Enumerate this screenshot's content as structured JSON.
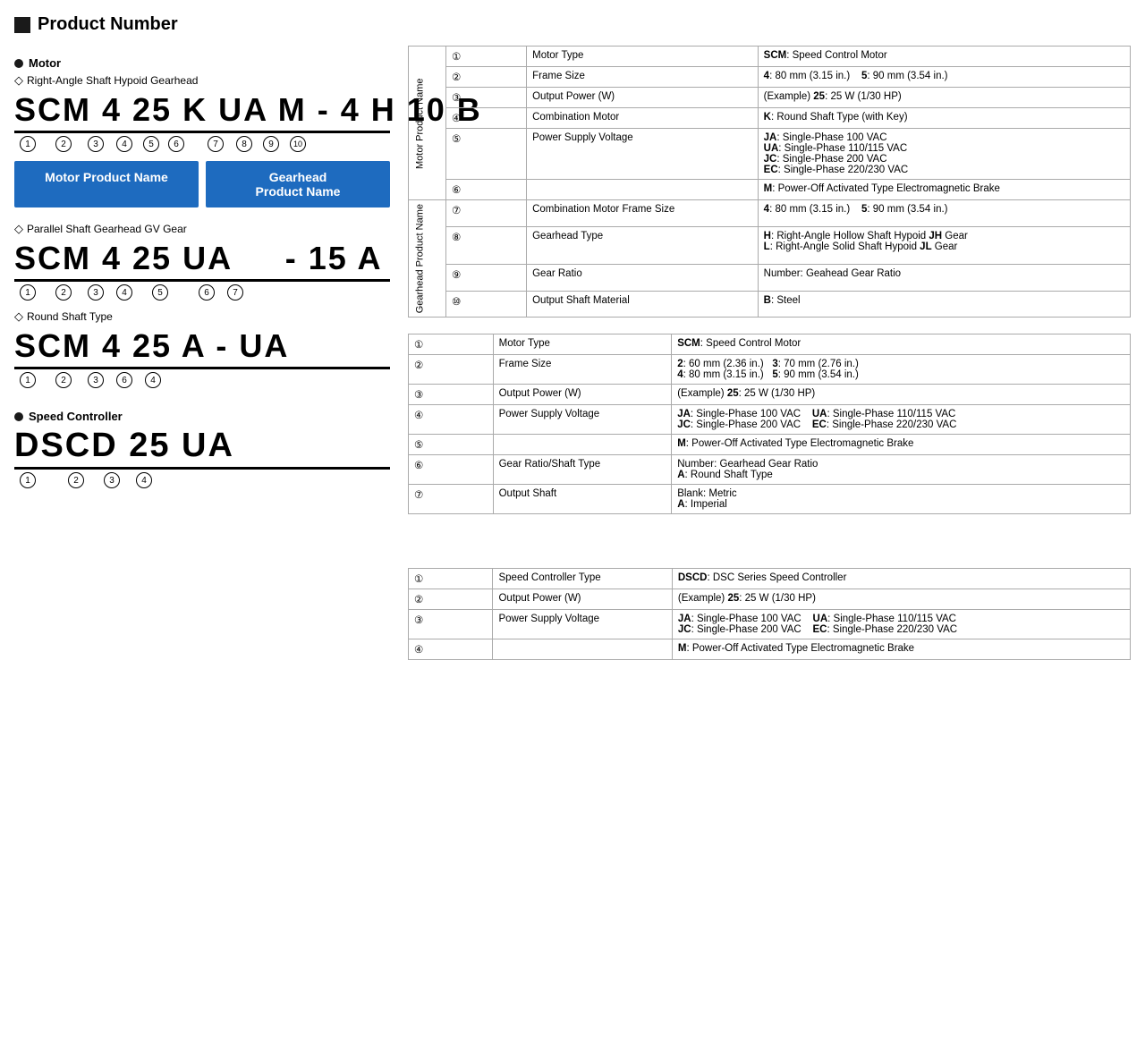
{
  "page": {
    "title": "Product Number",
    "sections": {
      "motor_label": "Motor",
      "right_angle_label": "Right-Angle Shaft Hypoid Gearhead",
      "parallel_label": "Parallel Shaft Gearhead GV Gear",
      "round_shaft_label": "Round Shaft Type",
      "speed_controller_label": "Speed Controller"
    },
    "codes": {
      "right_angle": "SCM 4 25 K UA M - 4 H 10 B",
      "parallel": "SCM 4 25 UA    - 15 A",
      "round_shaft": "SCM 4 25 A - UA"
    },
    "name_boxes": {
      "motor": "Motor Product Name",
      "gearhead": "Gearhead\nProduct Name"
    },
    "table1": {
      "group1_label": "Motor\nProduct\nName",
      "group2_label": "Gearhead\nProduct\nName",
      "rows": [
        {
          "num": "①",
          "field": "Motor Type",
          "value": "SCM: Speed Control Motor"
        },
        {
          "num": "②",
          "field": "Frame Size",
          "value": "4: 80 mm (3.15 in.)    5: 90 mm (3.54 in.)"
        },
        {
          "num": "③",
          "field": "Output Power (W)",
          "value": "(Example) 25: 25 W (1/30 HP)"
        },
        {
          "num": "④",
          "field": "Combination Motor",
          "value": "K: Round Shaft Type (with Key)"
        },
        {
          "num": "⑤",
          "field": "Power Supply Voltage",
          "value": "JA: Single-Phase 100 VAC\nUA: Single-Phase 110/115 VAC\nJC: Single-Phase 200 VAC\nEC: Single-Phase 220/230 VAC"
        },
        {
          "num": "⑥",
          "field": "",
          "value": "M: Power-Off Activated Type Electromagnetic Brake"
        },
        {
          "num": "⑦",
          "field": "Combination Motor\nFrame Size",
          "value": "4: 80 mm (3.15 in.)    5: 90 mm (3.54 in.)"
        },
        {
          "num": "⑧",
          "field": "Gearhead Type",
          "value": "H: Right-Angle Hollow Shaft Hypoid JH Gear\nL: Right-Angle Solid Shaft Hypoid JL Gear"
        },
        {
          "num": "⑨",
          "field": "Gear Ratio",
          "value": "Number: Geahead Gear Ratio"
        },
        {
          "num": "⑩",
          "field": "Output Shaft Material",
          "value": "B: Steel"
        }
      ]
    },
    "table2": {
      "rows": [
        {
          "num": "①",
          "field": "Motor Type",
          "value": "SCM: Speed Control Motor"
        },
        {
          "num": "②",
          "field": "Frame Size",
          "value": "2: 60 mm (2.36 in.)    3: 70 mm (2.76 in.)\n4: 80 mm (3.15 in.)    5: 90 mm (3.54 in.)"
        },
        {
          "num": "③",
          "field": "Output Power (W)",
          "value": "(Example) 25: 25 W (1/30 HP)"
        },
        {
          "num": "④",
          "field": "Power Supply Voltage",
          "value": "JA: Single-Phase 100 VAC    UA: Single-Phase 110/115 VAC\nJC: Single-Phase 200 VAC    EC: Single-Phase 220/230 VAC"
        },
        {
          "num": "⑤",
          "field": "",
          "value": "M: Power-Off Activated Type Electromagnetic Brake"
        },
        {
          "num": "⑥",
          "field": "Gear Ratio/Shaft\nType",
          "value": "Number: Gearhead Gear Ratio\nA: Round Shaft Type"
        },
        {
          "num": "⑦",
          "field": "Output Shaft",
          "value": "Blank: Metric\nA: Imperial"
        }
      ]
    },
    "table3": {
      "rows": [
        {
          "num": "①",
          "field": "Speed Controller\nType",
          "value": "DSCD: DSC Series Speed Controller"
        },
        {
          "num": "②",
          "field": "Output Power (W)",
          "value": "(Example) 25: 25 W (1/30 HP)"
        },
        {
          "num": "③",
          "field": "Power Supply Voltage",
          "value": "JA: Single-Phase 100 VAC    UA: Single-Phase 110/115 VAC\nJC: Single-Phase 200 VAC    EC: Single-Phase 220/230 VAC"
        },
        {
          "num": "④",
          "field": "",
          "value": "M: Power-Off Activated Type Electromagnetic Brake"
        }
      ]
    }
  }
}
